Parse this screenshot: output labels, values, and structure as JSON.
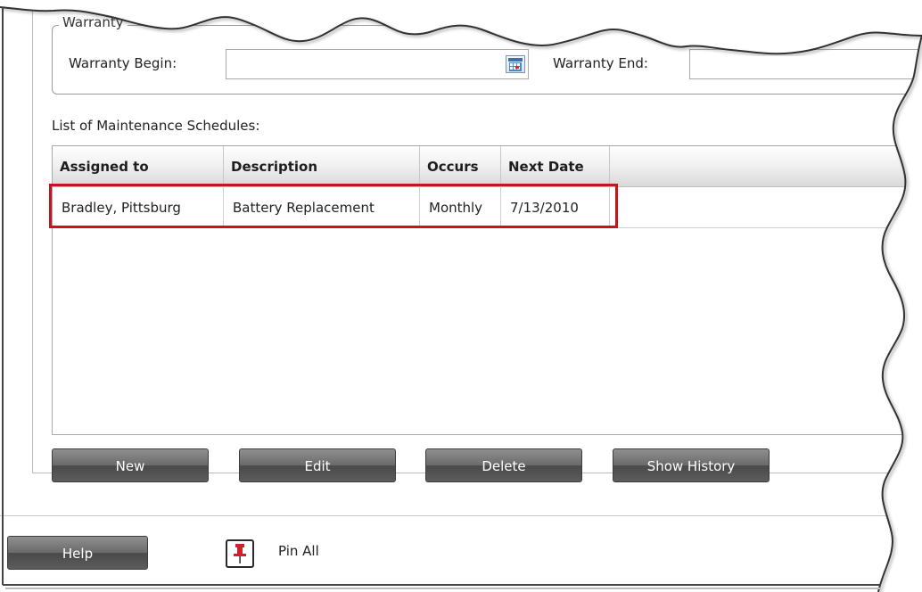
{
  "warranty": {
    "group_label": "Warranty",
    "begin_label": "Warranty Begin:",
    "begin_value": "",
    "end_label": "Warranty End:",
    "end_value": ""
  },
  "schedules": {
    "list_label": "List of Maintenance Schedules:",
    "columns": [
      "Assigned to",
      "Description",
      "Occurs",
      "Next Date"
    ],
    "rows": [
      [
        "Bradley, Pittsburg",
        "Battery Replacement",
        "Monthly",
        "7/13/2010"
      ]
    ]
  },
  "actions": {
    "new_label": "New",
    "edit_label": "Edit",
    "delete_label": "Delete",
    "history_label": "Show History"
  },
  "footer": {
    "help_label": "Help",
    "pin_label": "Pin All"
  },
  "colors": {
    "highlight": "#c4151c",
    "button": "#5c5c5c",
    "pin": "#d21f2b"
  }
}
